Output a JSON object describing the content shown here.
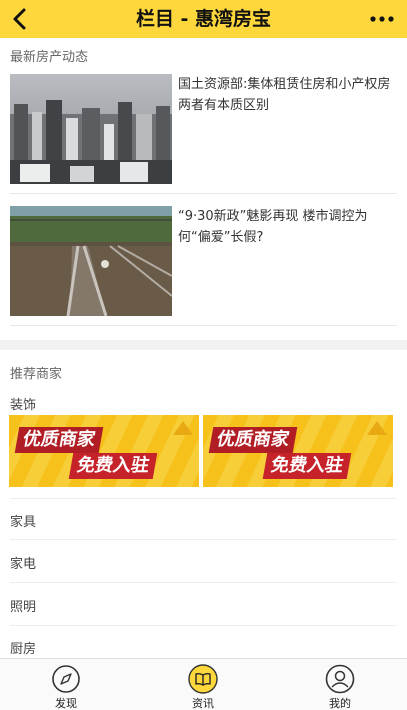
{
  "header": {
    "title": "栏目 - 惠湾房宝",
    "back_icon": "chevron-left-icon",
    "more_icon": "more-dots-icon",
    "accent_color": "#fed73d"
  },
  "news": {
    "section_title": "最新房产动态",
    "items": [
      {
        "title": "国土资源部:集体租赁住房和小产权房两者有本质区别",
        "thumb": "city-skyline-photo"
      },
      {
        "title": "“9·30新政”魅影再现 楼市调控为何“偏爱”长假?",
        "thumb": "railway-track-photo"
      }
    ]
  },
  "merchants": {
    "section_title": "推荐商家",
    "categories": [
      {
        "label": "装饰"
      },
      {
        "label": "家具"
      },
      {
        "label": "家电"
      },
      {
        "label": "照明"
      },
      {
        "label": "厨房"
      }
    ],
    "banners": [
      {
        "line1": "优质商家",
        "line2": "免费入驻"
      },
      {
        "line1": "优质商家",
        "line2": "免费入驻"
      }
    ]
  },
  "tabbar": {
    "tabs": [
      {
        "label": "发现",
        "icon": "compass-icon",
        "active": false
      },
      {
        "label": "资讯",
        "icon": "book-icon",
        "active": true
      },
      {
        "label": "我的",
        "icon": "user-icon",
        "active": false
      }
    ]
  }
}
